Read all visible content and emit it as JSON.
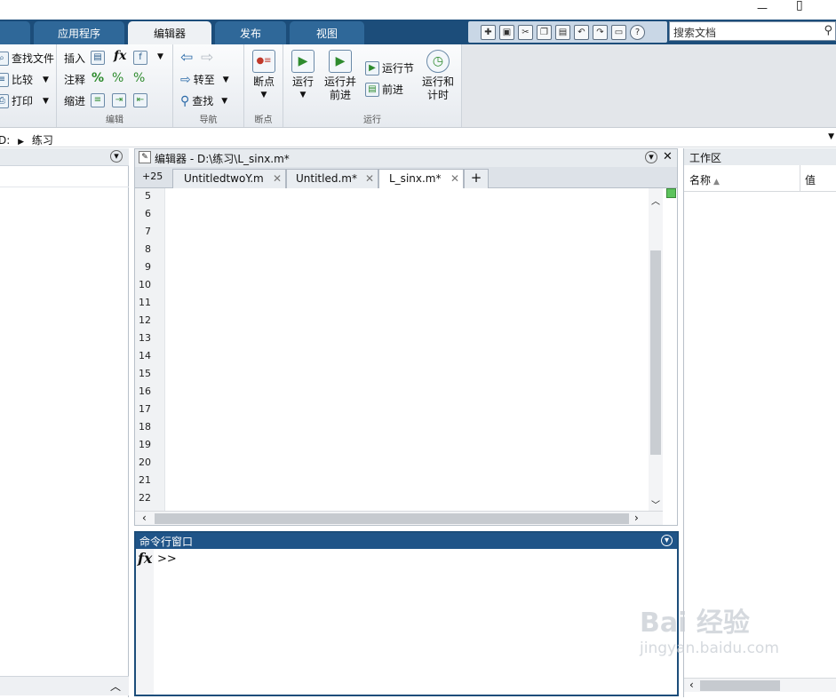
{
  "window": {
    "minimize_label": "—",
    "restore_label": "▯"
  },
  "tabs": [
    {
      "label": "",
      "active": false
    },
    {
      "label": "应用程序",
      "active": false
    },
    {
      "label": "编辑器",
      "active": true
    },
    {
      "label": "发布",
      "active": false
    },
    {
      "label": "视图",
      "active": false
    }
  ],
  "search": {
    "placeholder": "搜索文档"
  },
  "quick_access_icons": [
    "new-icon",
    "save-icon",
    "cut-icon",
    "copy-icon",
    "paste-icon",
    "undo-icon",
    "redo-icon",
    "switch-window-icon",
    "help-icon"
  ],
  "ribbon": {
    "file": {
      "find_files": "查找文件",
      "compare": "比较",
      "print": "打印"
    },
    "edit": {
      "insert": "插入",
      "comment": "注释",
      "indent": "缩进",
      "section_label": "编辑"
    },
    "navigate": {
      "goto": "转至",
      "find": "查找",
      "section_label": "导航"
    },
    "breakpoints": {
      "label": "断点",
      "section_label": "断点"
    },
    "run": {
      "run": "运行",
      "run_advance_1": "运行并",
      "run_advance_2": "前进",
      "run_section": "运行节",
      "advance": "前进",
      "run_time_1": "运行和",
      "run_time_2": "计时",
      "section_label": "运行"
    }
  },
  "address": {
    "drive": "D:",
    "folder": "练习"
  },
  "editor": {
    "title": "编辑器 - D:\\练习\\L_sinx.m*",
    "overflow_count": "+25",
    "tabs": [
      {
        "label": "UntitledtwoY.m",
        "active": false
      },
      {
        "label": "Untitled.m*",
        "active": false
      },
      {
        "label": "L_sinx.m*",
        "active": true
      }
    ],
    "add_tab": "+",
    "line_numbers": [
      "5",
      "6",
      "7",
      "8",
      "9",
      "10",
      "11",
      "12",
      "13",
      "14",
      "15",
      "16",
      "17",
      "18",
      "19",
      "20",
      "21",
      "22"
    ]
  },
  "command_window": {
    "title": "命令行窗口",
    "fx": "fx",
    "prompt": ">>"
  },
  "workspace": {
    "title": "工作区",
    "col_name": "名称",
    "col_value": "值"
  },
  "watermark": {
    "line1": "Bai 经验",
    "line2": "jingyan.baidu.com"
  }
}
